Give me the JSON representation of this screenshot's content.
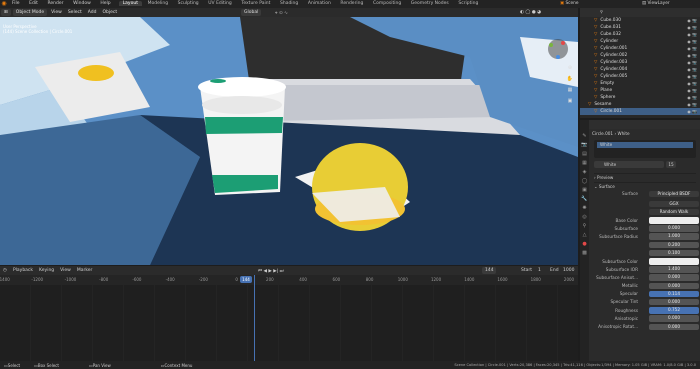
{
  "menu": [
    "File",
    "Edit",
    "Render",
    "Window",
    "Help"
  ],
  "workspaces": [
    "Layout",
    "Modeling",
    "Sculpting",
    "UV Editing",
    "Texture Paint",
    "Shading",
    "Animation",
    "Rendering",
    "Compositing",
    "Geometry Nodes",
    "Scripting"
  ],
  "active_workspace": "Layout",
  "scene": {
    "label": "Scene",
    "view_layer": "ViewLayer"
  },
  "viewport_header": {
    "mode": "Object Mode",
    "menus": [
      "View",
      "Select",
      "Add",
      "Object"
    ],
    "orientation": "Global"
  },
  "viewport_info": {
    "line1": "User Perspective",
    "line2": "(144) Scene Collection | Circle.001"
  },
  "outliner": {
    "items": [
      {
        "name": "Cube.030"
      },
      {
        "name": "Cube.031"
      },
      {
        "name": "Cube.032"
      },
      {
        "name": "Cylinder"
      },
      {
        "name": "Cylinder.001"
      },
      {
        "name": "Cylinder.002"
      },
      {
        "name": "Cylinder.003"
      },
      {
        "name": "Cylinder.004"
      },
      {
        "name": "Cylinder.005"
      },
      {
        "name": "Empty"
      },
      {
        "name": "Plane"
      },
      {
        "name": "Sphere"
      },
      {
        "name": "Sesame"
      },
      {
        "name": "Circle.001"
      }
    ]
  },
  "properties": {
    "object": "Circle.001",
    "material_tab": "White",
    "slot": "White",
    "material_name": "White",
    "users": "15",
    "preview_label": "Preview",
    "surface_label": "Surface",
    "surface_value": "Principled BSDF",
    "distribution": "GGX",
    "subsurface_method": "Random Walk",
    "rows": [
      {
        "label": "Base Color",
        "value": "",
        "kind": "swatch"
      },
      {
        "label": "Subsurface",
        "value": "0.000",
        "kind": "num"
      },
      {
        "label": "Subsurface Radius",
        "value": "1.000",
        "kind": "num"
      },
      {
        "label": "",
        "value": "0.200",
        "kind": "num"
      },
      {
        "label": "",
        "value": "0.100",
        "kind": "num"
      },
      {
        "label": "Subsurface Color",
        "value": "",
        "kind": "swatch"
      },
      {
        "label": "Subsurface IOR",
        "value": "1.400",
        "kind": "num"
      },
      {
        "label": "Subsurface Anisot...",
        "value": "0.000",
        "kind": "num"
      },
      {
        "label": "Metallic",
        "value": "0.000",
        "kind": "num"
      },
      {
        "label": "Specular",
        "value": "0.114",
        "kind": "blue"
      },
      {
        "label": "Specular Tint",
        "value": "0.000",
        "kind": "num"
      },
      {
        "label": "Roughness",
        "value": "0.752",
        "kind": "blue"
      },
      {
        "label": "Anisotropic",
        "value": "0.000",
        "kind": "num"
      },
      {
        "label": "Anisotropic Rotat...",
        "value": "0.000",
        "kind": "num"
      }
    ]
  },
  "timeline": {
    "menus": [
      "Playback",
      "Keying",
      "View",
      "Marker"
    ],
    "current": "144",
    "start_label": "Start",
    "start": "1",
    "end_label": "End",
    "end": "1000",
    "ticks": [
      "-1400",
      "-1200",
      "-1000",
      "-800",
      "-600",
      "-400",
      "-200",
      "0",
      "200",
      "400",
      "600",
      "800",
      "1000",
      "1200",
      "1400",
      "1600",
      "1800",
      "2000"
    ]
  },
  "status": {
    "left": [
      "Select",
      "Box Select",
      "Pan View",
      "Context Menu"
    ],
    "right": "Scene Collection | Circle.001 | Verts:20,386 | Faces:20,345 | Tris:41,116 | Objects:1/394 | Memory: 1.05 GiB | VRAM: 1.0/8.0 GiB | 3.0.0"
  }
}
